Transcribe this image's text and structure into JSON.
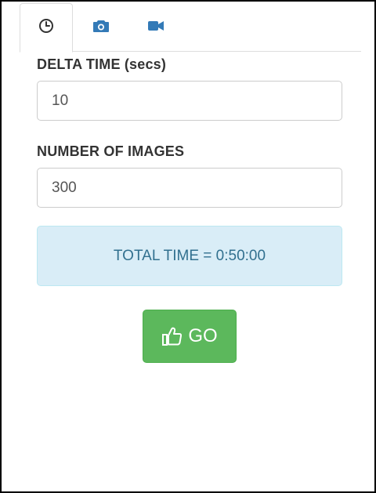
{
  "tabs": [
    {
      "icon": "clock-icon",
      "active": true
    },
    {
      "icon": "camera-icon",
      "active": false
    },
    {
      "icon": "video-camera-icon",
      "active": false
    }
  ],
  "form": {
    "delta_time_label": "DELTA TIME (secs)",
    "delta_time_value": "10",
    "num_images_label": "NUMBER OF IMAGES",
    "num_images_value": "300"
  },
  "info": {
    "total_time_text": "TOTAL TIME = 0:50:00"
  },
  "go_button": {
    "label": "GO",
    "icon": "thumbs-up-icon"
  },
  "colors": {
    "accent_blue": "#337ab7",
    "info_bg": "#d9edf7",
    "info_text": "#31708f",
    "success_green": "#5cb85c"
  }
}
